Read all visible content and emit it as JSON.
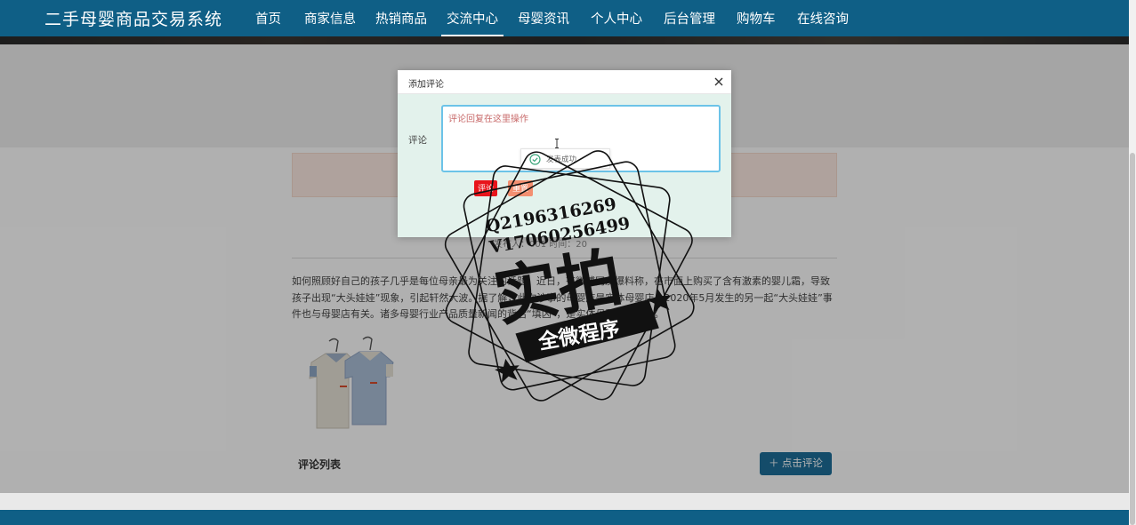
{
  "header": {
    "brand": "二手母婴商品交易系统",
    "nav": [
      {
        "label": "首页",
        "active": false
      },
      {
        "label": "商家信息",
        "active": false
      },
      {
        "label": "热销商品",
        "active": false
      },
      {
        "label": "交流中心",
        "active": true
      },
      {
        "label": "母婴资讯",
        "active": false
      },
      {
        "label": "个人中心",
        "active": false
      },
      {
        "label": "后台管理",
        "active": false
      },
      {
        "label": "购物车",
        "active": false
      },
      {
        "label": "在线咨询",
        "active": false
      }
    ]
  },
  "page": {
    "meta": "发布人：001  时间：20",
    "article": "如何照顾好自己的孩子几乎是每位母亲最为关注的话题。近日，有微博网友爆料称，在市面上购买了含有激素的婴儿霜，导致孩子出现“大头娃娃”现象，引起轩然大波。据了解，此次涉事的母婴店是实体母婴店。2020年5月发生的另一起“大头娃娃”事件也与母婴店有关。诸多母婴行业产品质量新闻的背后“填凶”，是实体母婴店的混乱。",
    "comments_title": "评论列表",
    "comment_button": "点击评论"
  },
  "dialog": {
    "title": "添加评论",
    "field_label": "评论",
    "input_value": "",
    "input_placeholder": "评论回复在这里操作",
    "submit_label": "评论",
    "reset_label": "重置",
    "toast_text": "发表成功"
  },
  "watermark": {
    "qq": "Q2196316269",
    "v": "V17060256499",
    "big": "实拍",
    "ribbon": "全微程序"
  },
  "colors": {
    "header": "#0f5f86",
    "dialog_bg": "#e3f2ec",
    "submit": "#e8141b",
    "reset": "#f38f71",
    "comment_button": "#1d6e99"
  }
}
